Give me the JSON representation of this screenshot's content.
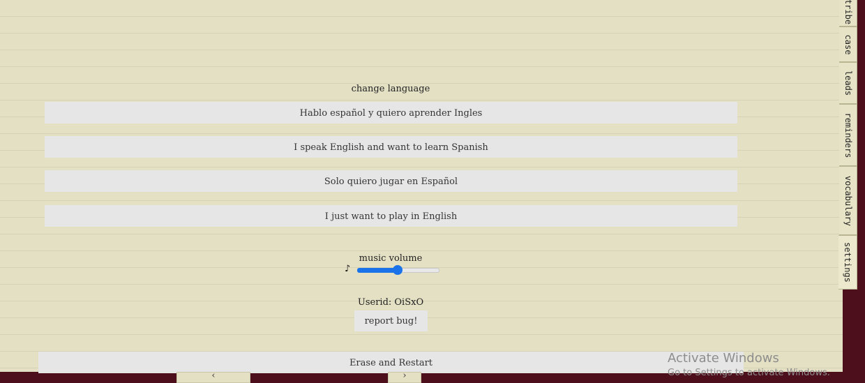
{
  "side_tabs": [
    {
      "label": "tribe"
    },
    {
      "label": "case"
    },
    {
      "label": "leads"
    },
    {
      "label": "reminders"
    },
    {
      "label": "vocabulary"
    },
    {
      "label": "settings"
    }
  ],
  "settings": {
    "language_heading": "change language",
    "language_options": [
      "Hablo español y quiero aprender Ingles",
      "I speak English and want to learn Spanish",
      "Solo quiero jugar en Español",
      "I just want to play in English"
    ],
    "music_label": "music volume",
    "music_icon": "♪",
    "music_volume": 0.5,
    "userid_text": "Userid: OiSxO",
    "report_bug_label": "report bug!",
    "erase_label": "Erase and Restart"
  },
  "bottom_nav": {
    "prev_icon": "‹",
    "next_icon": "›"
  },
  "watermark": {
    "title": "Activate Windows",
    "subtitle": "Go to Settings to activate Windows."
  },
  "colors": {
    "paper": "#e4e0c4",
    "background": "#4e0f1c",
    "accent": "#1a73e8"
  }
}
